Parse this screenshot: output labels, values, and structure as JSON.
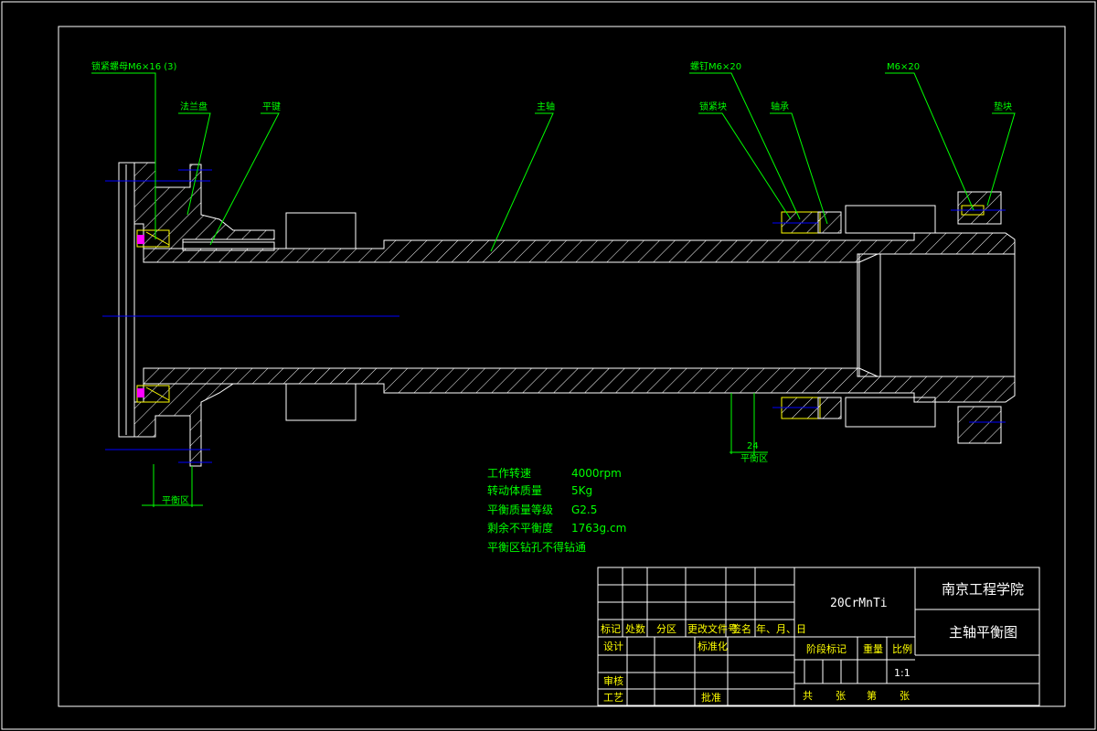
{
  "leaders": {
    "lock_nut": "锁紧螺母M6×16 (3)",
    "flange_cover": "法兰盘",
    "flat_key": "平键",
    "main_shaft": "主轴",
    "bolt": "螺钉M6×20",
    "lock_block": "锁紧块",
    "bearing": "轴承",
    "screw": "M6×20",
    "pad": "垫块"
  },
  "zones": {
    "left_zone_label": "平衡区",
    "right_zone_label": "平衡区",
    "right_zone_dim": "24"
  },
  "notes": {
    "rows": [
      {
        "label": "工作转速",
        "value": "4000rpm"
      },
      {
        "label": "转动体质量",
        "value": "5Kg"
      },
      {
        "label": "平衡质量等级",
        "value": "G2.5"
      },
      {
        "label": "剩余不平衡度",
        "value": "1763g.cm"
      }
    ],
    "last": "平衡区钻孔不得钻通"
  },
  "title_block": {
    "material": "20CrMnTi",
    "school": "南京工程学院",
    "drawing_name": "主轴平衡图",
    "header_labels": [
      "标记",
      "处数",
      "分区",
      "更改文件号",
      "签名",
      "年、月、日"
    ],
    "design": "设计",
    "standardize": "标准化",
    "review": "审核",
    "process": "工艺",
    "approve": "批准",
    "stage_mark": "阶段标记",
    "weight": "重量",
    "scale": "比例",
    "scale_value": "1:1",
    "total": "共",
    "sheet_unit_1": "张",
    "sheet_no": "第",
    "sheet_unit_2": "张"
  },
  "colors": {
    "section_lines": "#ffffff",
    "leader_lines": "#00ff00",
    "center_lines": "#0000ff",
    "fasteners": "#ffff00",
    "detail": "#ff00ff",
    "background": "#000000"
  }
}
